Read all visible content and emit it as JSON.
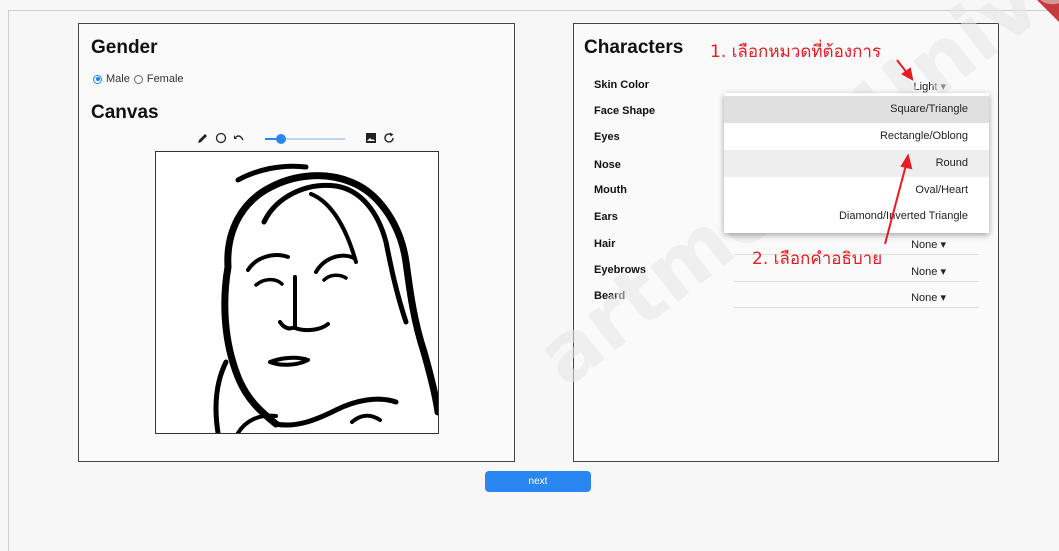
{
  "gender": {
    "title": "Gender",
    "options": [
      "Male",
      "Female"
    ],
    "selected": "Male"
  },
  "canvas": {
    "title": "Canvas",
    "tools": [
      "pencil-icon",
      "circle-icon",
      "undo-icon",
      "brush-size-slider",
      "image-icon",
      "refresh-icon"
    ],
    "brush_size_fraction": 0.2
  },
  "characters": {
    "title": "Characters",
    "rows": [
      {
        "label": "Skin Color",
        "value": "Light"
      },
      {
        "label": "Face Shape",
        "value": ""
      },
      {
        "label": "Eyes",
        "value": ""
      },
      {
        "label": "Nose",
        "value": ""
      },
      {
        "label": "Mouth",
        "value": ""
      },
      {
        "label": "Ears",
        "value": ""
      },
      {
        "label": "Hair",
        "value": "None"
      },
      {
        "label": "Eyebrows",
        "value": "None"
      },
      {
        "label": "Beard",
        "value": "None"
      }
    ],
    "dropdown_arrow": "▾"
  },
  "dropdown": {
    "options": [
      "Square/Triangle",
      "Rectangle/Oblong",
      "Round",
      "Oval/Heart",
      "Diamond/Inverted Triangle"
    ],
    "selected": "Square/Triangle",
    "hovered": "Round"
  },
  "annotations": {
    "step1": "1. เลือกหมวดที่ต้องการ",
    "step2": "2. เลือกคำอธิบาย"
  },
  "next_label": "next",
  "watermark": "artment University",
  "colors": {
    "accent": "#2a86f0",
    "annotation": "#e51c23"
  }
}
